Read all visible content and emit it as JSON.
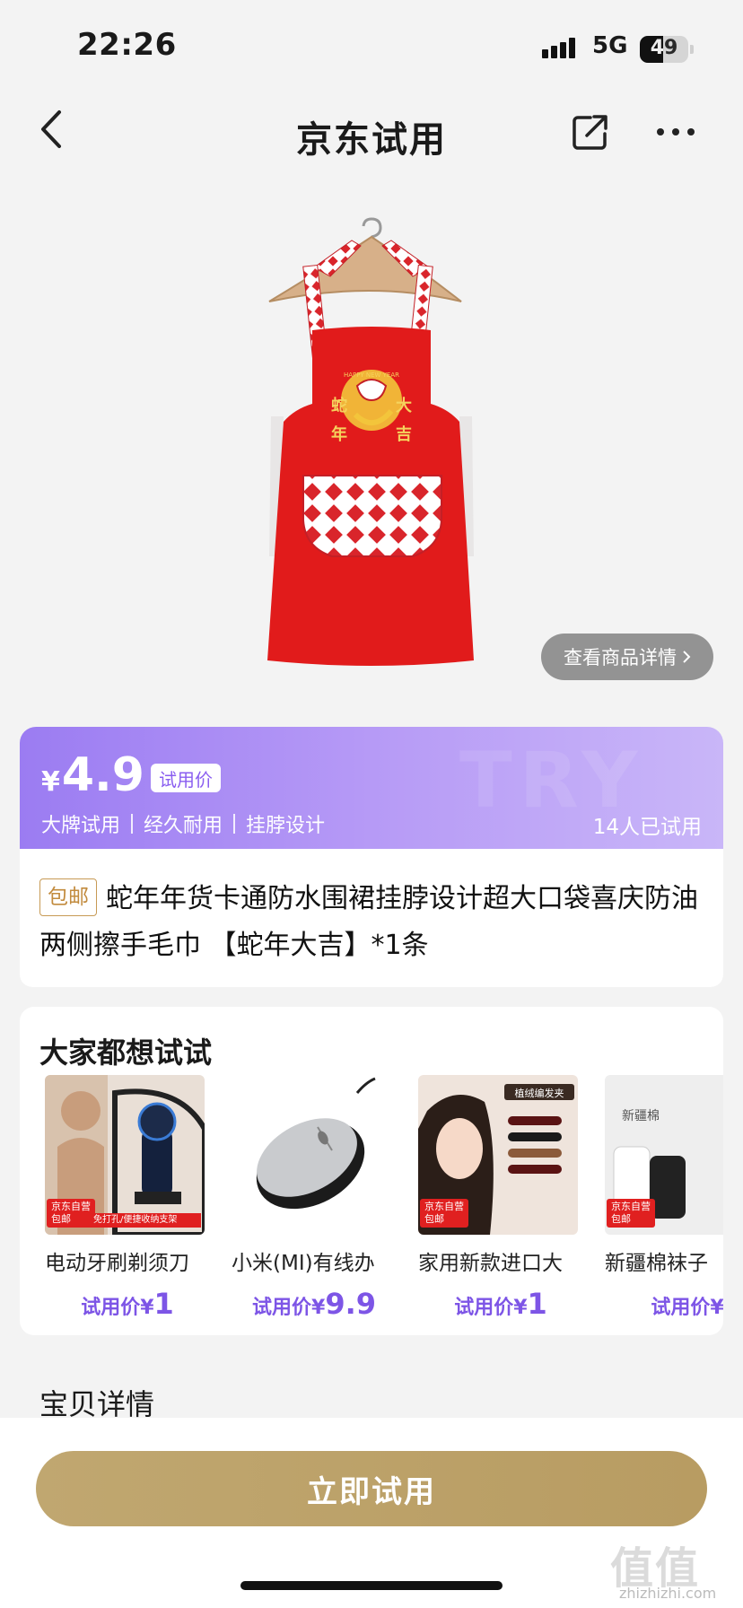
{
  "status_bar": {
    "time": "22:26",
    "network": "5G",
    "battery": "49",
    "battery_level": 0.49
  },
  "nav": {
    "title": "京东试用"
  },
  "hero": {
    "detail_link": "查看商品详情",
    "apron_text": {
      "happy_new_year": "HAPPY NEW YEAR",
      "char1": "蛇",
      "char2": "年",
      "char3": "大",
      "char4": "吉"
    }
  },
  "price": {
    "currency": "¥",
    "value": "4.9",
    "tag": "试用价",
    "watermark": "TRY",
    "features": [
      "大牌试用",
      "经久耐用",
      "挂脖设计"
    ],
    "tried_count": "14人已试用"
  },
  "product": {
    "free_shipping": "包邮",
    "title": "蛇年年货卡通防水围裙挂脖设计超大口袋喜庆防油两侧擦手毛巾 【蛇年大吉】*1条"
  },
  "recommend": {
    "heading": "大家都想试试",
    "badge": "京东自营",
    "badge2": "包邮",
    "items": [
      {
        "name": "电动牙刷剃须刀",
        "price_label": "试用价¥",
        "price": "1",
        "strip": "免打孔/便捷收纳支架"
      },
      {
        "name": "小米(MI)有线办",
        "price_label": "试用价¥",
        "price": "9.9"
      },
      {
        "name": "家用新款进口大",
        "price_label": "试用价¥",
        "price": "1",
        "img_text": "植绒编发夹"
      },
      {
        "name": "新疆棉袜子",
        "price_label": "试用价¥",
        "price": "",
        "img_text": "新疆棉"
      }
    ]
  },
  "detail_section": {
    "heading": "宝贝详情"
  },
  "bottom": {
    "try_button": "立即试用"
  },
  "watermark": {
    "glyphs": "值值值",
    "url": "zhizhizhi.com"
  },
  "colors": {
    "accent_purple": "#9b7cf2",
    "price_purple": "#7d55e6",
    "gold_button": "#bea36a",
    "apron_red": "#e11b1b"
  }
}
